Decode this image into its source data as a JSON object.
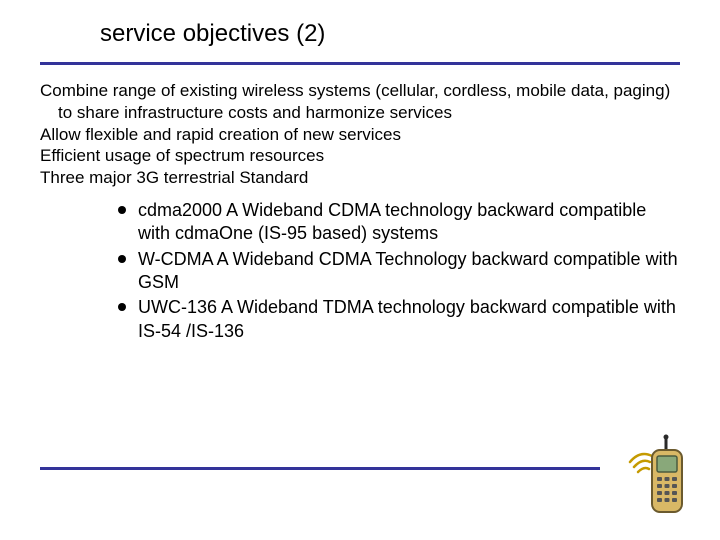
{
  "title": "service objectives (2)",
  "paragraphs": [
    "Combine range of existing wireless systems (cellular, cordless, mobile data, paging) to share infrastructure costs and harmonize services",
    "Allow flexible and rapid creation of new services",
    "Efficient usage of spectrum resources",
    "Three major 3G terrestrial Standard"
  ],
  "bullets": [
    "cdma2000   A  Wideband CDMA technology backward compatible with cdmaOne (IS-95 based) systems",
    "W-CDMA  A Wideband CDMA Technology backward compatible with GSM",
    "UWC-136  A Wideband TDMA technology backward compatible with IS-54 /IS-136"
  ],
  "colors": {
    "rule": "#333399"
  }
}
